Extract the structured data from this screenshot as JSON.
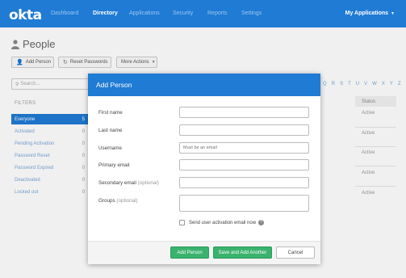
{
  "header": {
    "logo": "okta",
    "nav": [
      "Dashboard",
      "Directory",
      "Applications",
      "Security",
      "Reports",
      "Settings"
    ],
    "active_nav": "Directory",
    "my_apps": "My Applications"
  },
  "page": {
    "title": "People",
    "buttons": {
      "add_person": "Add Person",
      "reset_passwords": "Reset Passwords",
      "more_actions": "More Actions"
    }
  },
  "sidebar": {
    "search_placeholder": "Search...",
    "filters_label": "FILTERS",
    "filters": [
      {
        "label": "Everyone",
        "count": "5"
      },
      {
        "label": "Activated",
        "count": "0"
      },
      {
        "label": "Pending Activation",
        "count": "0"
      },
      {
        "label": "Password Reset",
        "count": "0"
      },
      {
        "label": "Password Expired",
        "count": "0"
      },
      {
        "label": "Deactivated",
        "count": "0"
      },
      {
        "label": "Locked out",
        "count": "0"
      }
    ]
  },
  "table": {
    "alphabet": "Q R S T U V W X Y Z",
    "status_header": "Status",
    "statuses": [
      "Active",
      "Active",
      "Active",
      "Active",
      "Active"
    ]
  },
  "modal": {
    "title": "Add Person",
    "fields": {
      "first_name": "First name",
      "last_name": "Last name",
      "username": "Username",
      "username_placeholder": "Must be an email",
      "primary_email": "Primary email",
      "secondary_email": "Secondary email",
      "secondary_email_opt": "(optional)",
      "groups": "Groups",
      "groups_opt": "(optional)"
    },
    "send_activation": "Send user activation email now",
    "buttons": {
      "add_person": "Add Person",
      "save_and_add_another": "Save and Add Another",
      "cancel": "Cancel"
    }
  }
}
